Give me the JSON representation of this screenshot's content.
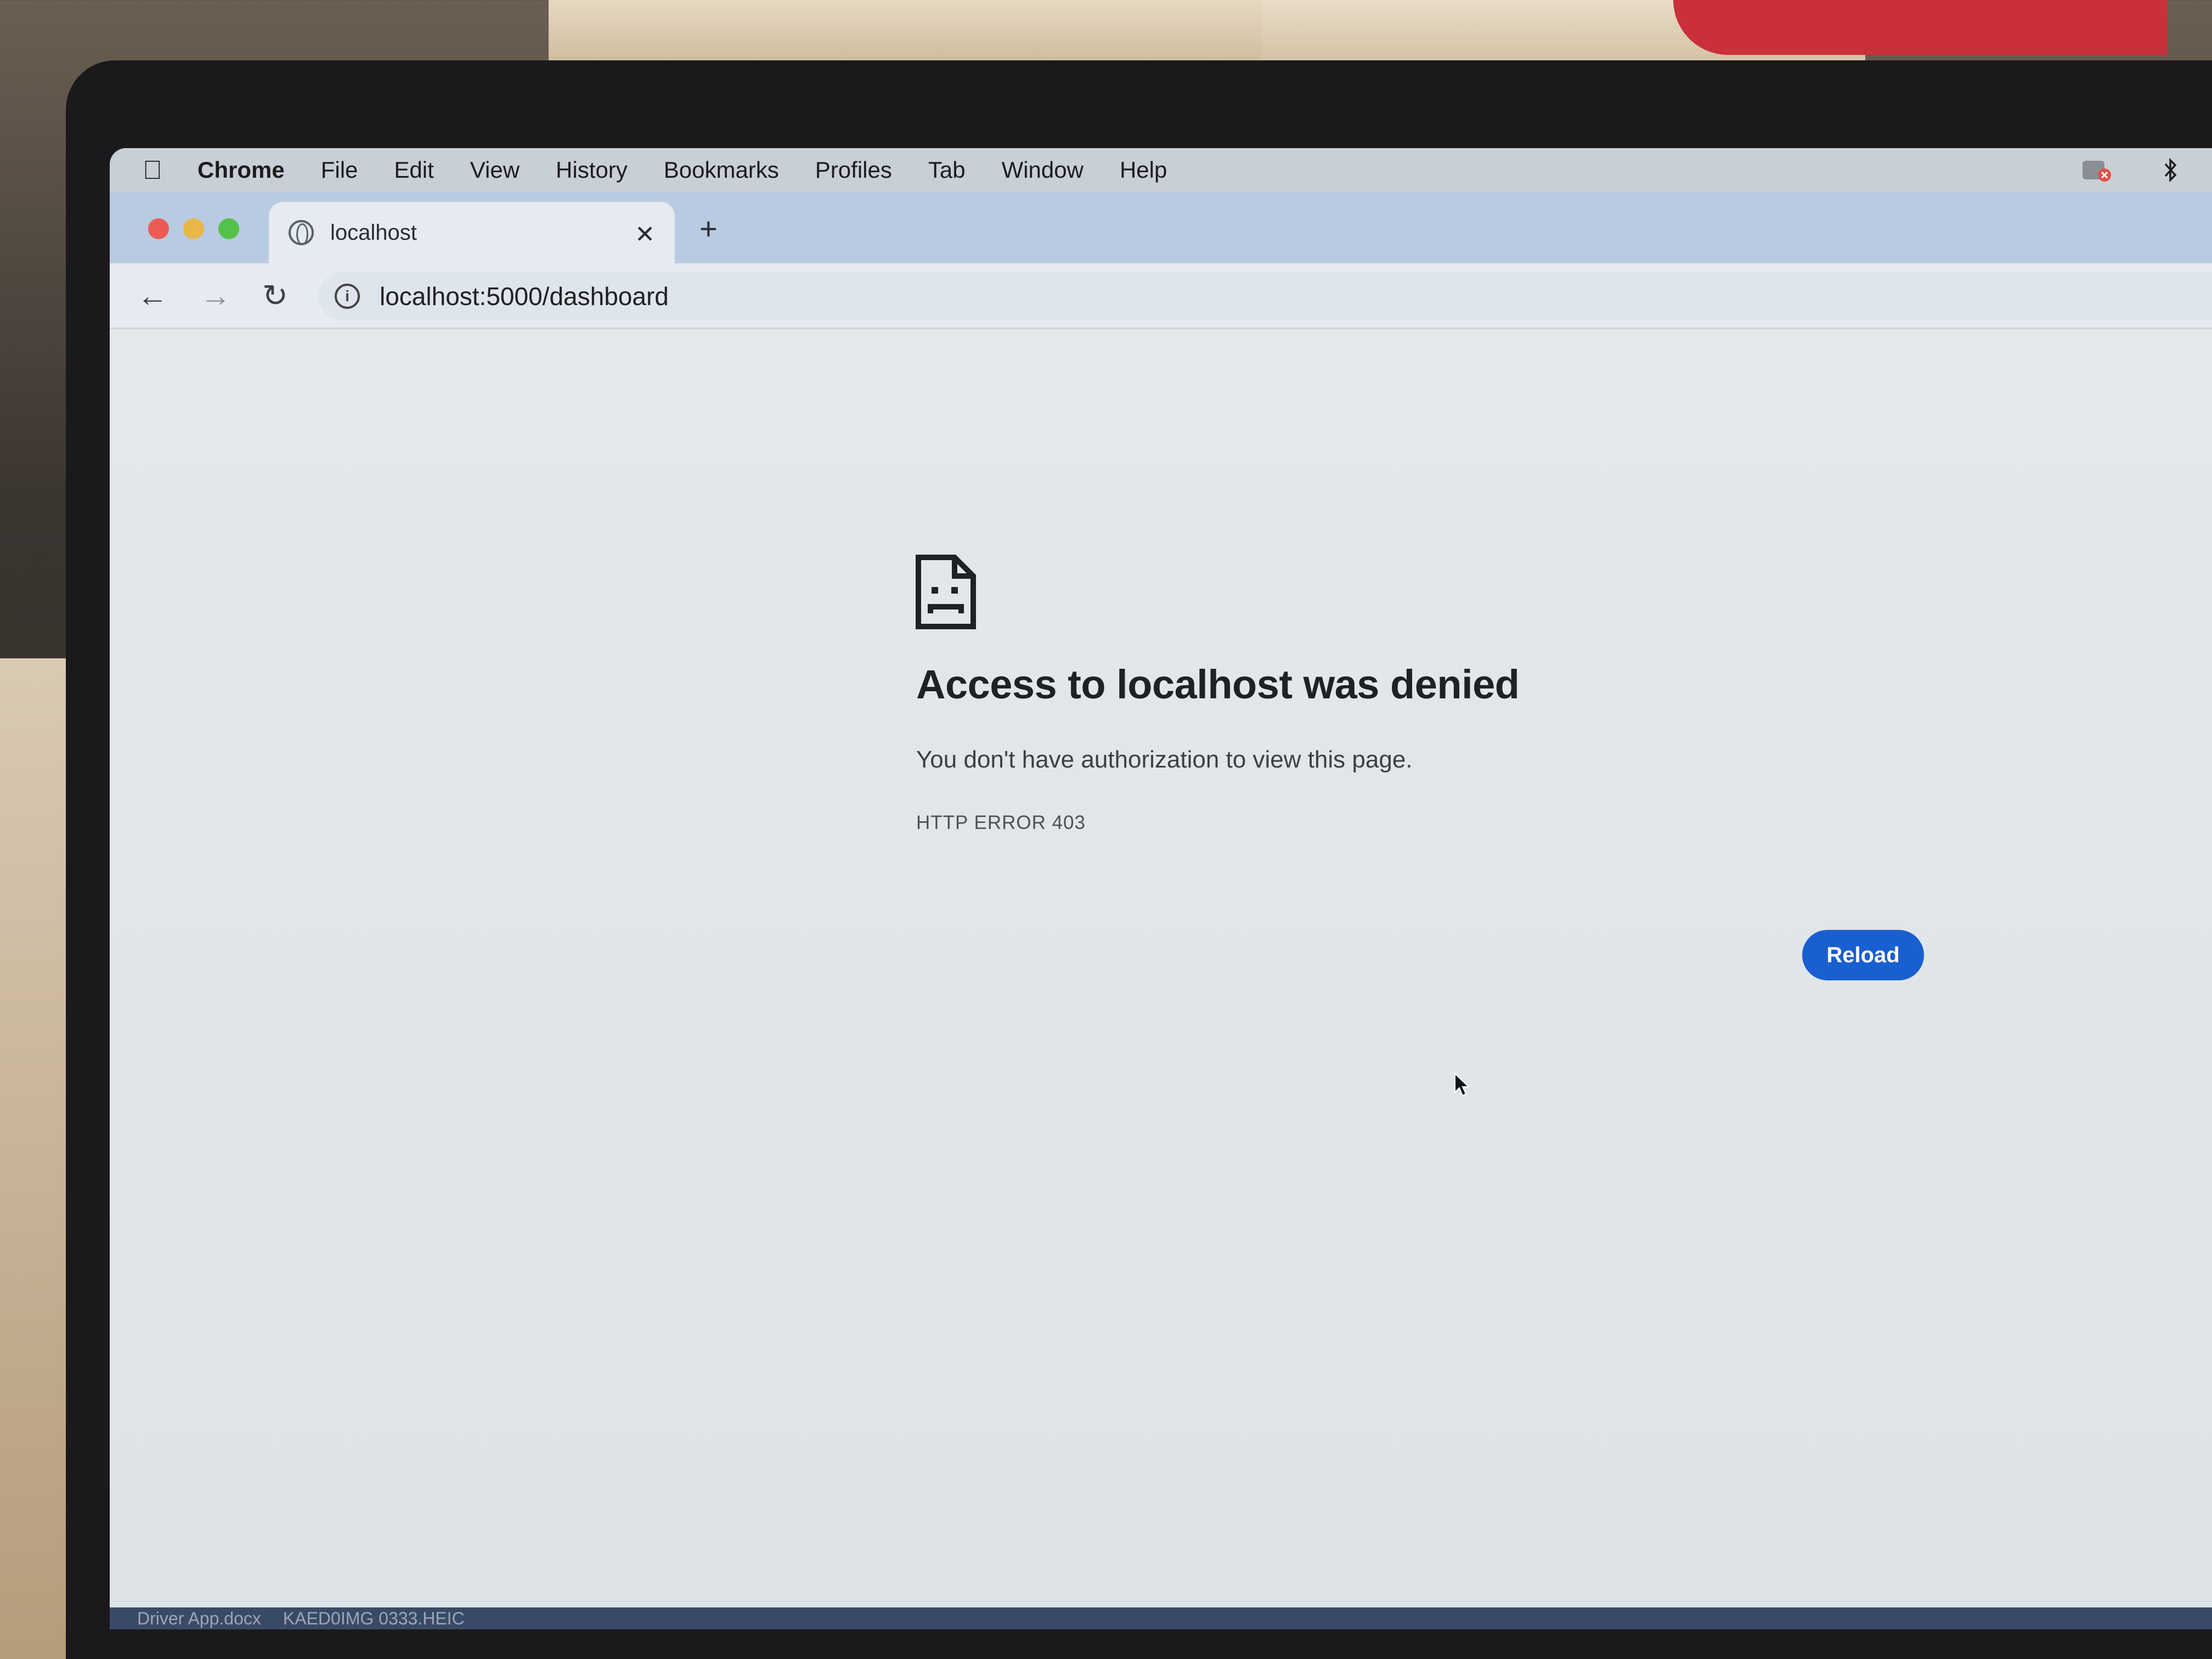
{
  "menubar": {
    "app_name": "Chrome",
    "items": [
      "File",
      "Edit",
      "View",
      "History",
      "Bookmarks",
      "Profiles",
      "Tab",
      "Window",
      "Help"
    ]
  },
  "tab": {
    "title": "localhost",
    "icon": "globe-icon"
  },
  "toolbar": {
    "url": "localhost:5000/dashboard"
  },
  "error_page": {
    "icon": "sad-document-icon",
    "title": "Access to localhost was denied",
    "description": "You don't have authorization to view this page.",
    "error_code": "HTTP ERROR 403",
    "reload_label": "Reload"
  },
  "dock": {
    "items": [
      "Driver App.docx",
      "KAED0IMG 0333.HEIC"
    ]
  },
  "colors": {
    "accent": "#1a5fd0",
    "tabstrip": "#b9cbe0",
    "page_bg": "#e3e7ea"
  }
}
